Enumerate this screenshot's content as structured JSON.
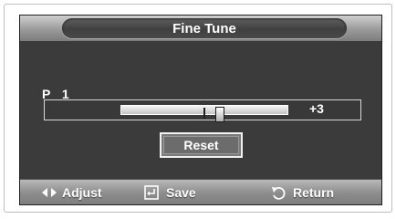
{
  "title": "Fine Tune",
  "channel": {
    "prefix": "P",
    "number": "1"
  },
  "slider": {
    "value": 3,
    "min": -16,
    "max": 16,
    "value_label": "+3"
  },
  "reset_label": "Reset",
  "hints": {
    "adjust": {
      "icon": "left-right-arrows-icon",
      "label": "Adjust"
    },
    "save": {
      "icon": "enter-icon",
      "label": "Save"
    },
    "return": {
      "icon": "return-icon",
      "label": "Return"
    }
  },
  "colors": {
    "panel": "#3b3b3b",
    "text": "#ffffff",
    "track": "#d8d8d8"
  }
}
